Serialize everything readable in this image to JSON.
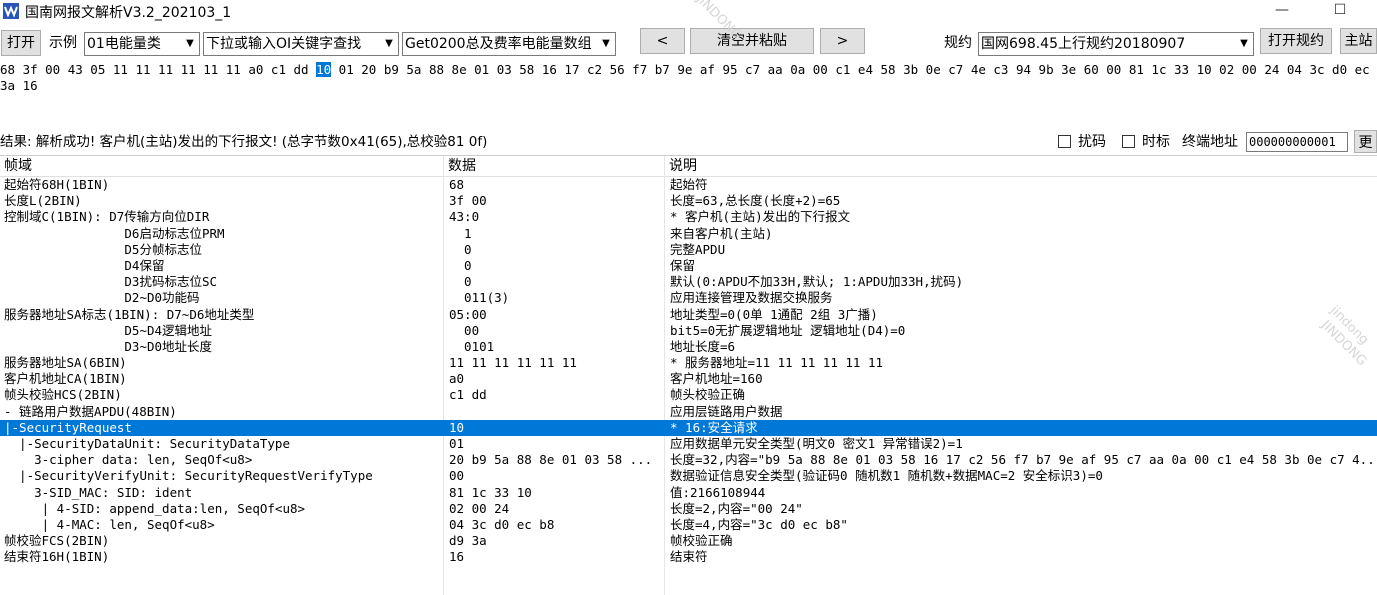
{
  "window": {
    "title": "国南网报文解析V3.2_202103_1",
    "minimize": "—",
    "maximize": "☐"
  },
  "toolbar": {
    "open_label": "打开",
    "example_label": "示例",
    "example_select": "01电能量类",
    "oi_select": "下拉或输入OI关键字查找",
    "get_select": "Get0200总及费率电能量数组",
    "prev_label": "<",
    "clear_paste_label": "清空并粘贴",
    "next_label": ">",
    "protocol_label": "规约",
    "protocol_select": "国网698.45上行规约20180907",
    "open_protocol_label": "打开规约",
    "master_label": "主站"
  },
  "hex": {
    "before_sel": "68 3f 00 43 05 11 11 11 11 11 11 a0 c1 dd ",
    "selected": "10",
    "after_sel": " 01 20 b9 5a 88 8e 01 03 58 16 17 c2 56 f7 b7 9e af 95 c7 aa 0a 00 c1 e4 58 3b 0e c7 4e c3 94 9b 3e 60 00 81 1c 33 10 02 00 24 04 3c d0 ec b8 d9",
    "line2": "3a 16"
  },
  "result": {
    "text": "结果: 解析成功! 客户机(主站)发出的下行报文! (总字节数0x41(65),总校验81 0f)",
    "scramble_label": "扰码",
    "timestamp_label": "时标",
    "terminal_addr_label": "终端地址",
    "terminal_addr_value": "000000000001",
    "more_button": "更"
  },
  "grid": {
    "headers": [
      "帧域",
      "数据",
      "说明"
    ],
    "rows": [
      {
        "field": "起始符68H(1BIN)",
        "data": "68",
        "desc": "起始符"
      },
      {
        "field": "长度L(2BIN)",
        "data": "3f 00",
        "desc": "长度=63,总长度(长度+2)=65"
      },
      {
        "field": "控制域C(1BIN): D7传输方向位DIR",
        "data": "43:0",
        "desc": "* 客户机(主站)发出的下行报文"
      },
      {
        "field": "                D6启动标志位PRM",
        "data": "  1",
        "desc": "来自客户机(主站)"
      },
      {
        "field": "                D5分帧标志位",
        "data": "  0",
        "desc": "完整APDU"
      },
      {
        "field": "                D4保留",
        "data": "  0",
        "desc": "保留"
      },
      {
        "field": "                D3扰码标志位SC",
        "data": "  0",
        "desc": "默认(0:APDU不加33H,默认; 1:APDU加33H,扰码)"
      },
      {
        "field": "                D2~D0功能码",
        "data": "  011(3)",
        "desc": "应用连接管理及数据交换服务"
      },
      {
        "field": "服务器地址SA标志(1BIN): D7~D6地址类型",
        "data": "05:00",
        "desc": "地址类型=0(0单 1通配 2组 3广播)"
      },
      {
        "field": "                D5~D4逻辑地址",
        "data": "  00",
        "desc": "bit5=0无扩展逻辑地址 逻辑地址(D4)=0"
      },
      {
        "field": "                D3~D0地址长度",
        "data": "  0101",
        "desc": "地址长度=6"
      },
      {
        "field": "服务器地址SA(6BIN)",
        "data": "11 11 11 11 11 11",
        "desc": "* 服务器地址=11 11 11 11 11 11"
      },
      {
        "field": "客户机地址CA(1BIN)",
        "data": "a0",
        "desc": "客户机地址=160"
      },
      {
        "field": "帧头校验HCS(2BIN)",
        "data": "c1 dd",
        "desc": "帧头校验正确"
      },
      {
        "field": "- 链路用户数据APDU(48BIN)",
        "data": "",
        "desc": "应用层链路用户数据"
      },
      {
        "field": "|-SecurityRequest",
        "data": "10",
        "desc": "* 16:安全请求",
        "selected": "true"
      },
      {
        "field": "  |-SecurityDataUnit: SecurityDataType",
        "data": "01",
        "desc": "应用数据单元安全类型(明文0 密文1 异常错误2)=1"
      },
      {
        "field": "    3-cipher data: len, SeqOf<u8>",
        "data": "20 b9 5a 88 8e 01 03 58 ...",
        "desc": "长度=32,内容=\"b9 5a 88 8e 01 03 58 16 17 c2 56 f7 b7 9e af 95 c7 aa 0a 00 c1 e4 58 3b 0e c7 4..."
      },
      {
        "field": "  |-SecurityVerifyUnit: SecurityRequestVerifyType",
        "data": "00",
        "desc": "数据验证信息安全类型(验证码0 随机数1 随机数+数据MAC=2 安全标识3)=0"
      },
      {
        "field": "    3-SID_MAC: SID: ident",
        "data": "81 1c 33 10",
        "desc": "值:2166108944"
      },
      {
        "field": "     | 4-SID: append_data:len, SeqOf<u8>",
        "data": "02 00 24",
        "desc": "长度=2,内容=\"00 24\""
      },
      {
        "field": "     | 4-MAC: len, SeqOf<u8>",
        "data": "04 3c d0 ec b8",
        "desc": "长度=4,内容=\"3c d0 ec b8\""
      },
      {
        "field": "帧校验FCS(2BIN)",
        "data": "d9 3a",
        "desc": "帧校验正确"
      },
      {
        "field": "结束符16H(1BIN)",
        "data": "16",
        "desc": "结束符"
      }
    ]
  },
  "watermarks": [
    "JINDONG",
    "jindong",
    "JINDONG"
  ]
}
